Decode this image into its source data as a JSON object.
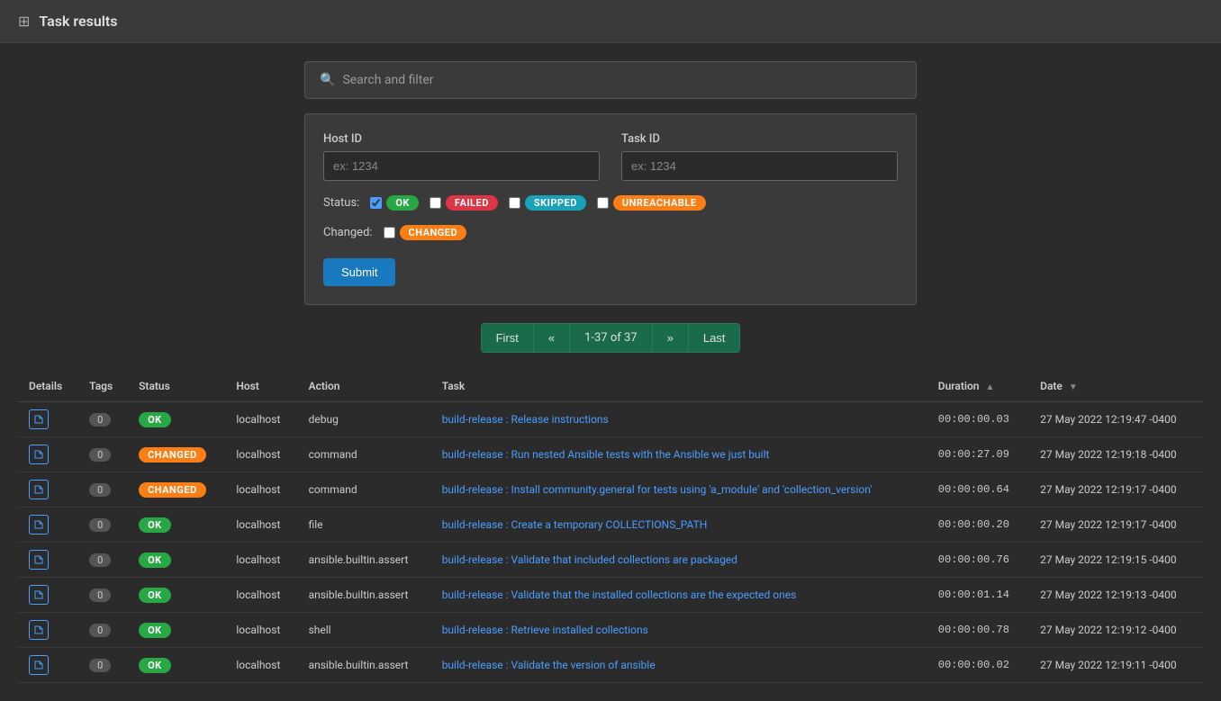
{
  "header": {
    "icon": "⊞",
    "title": "Task results"
  },
  "search": {
    "placeholder": "Search and filter"
  },
  "filters": {
    "host_id_label": "Host ID",
    "host_id_placeholder": "ex: 1234",
    "task_id_label": "Task ID",
    "task_id_placeholder": "ex: 1234",
    "status_label": "Status:",
    "changed_label": "Changed:",
    "submit_label": "Submit"
  },
  "status_badges": [
    {
      "label": "OK",
      "class": "badge-ok",
      "checked": true
    },
    {
      "label": "FAILED",
      "class": "badge-failed",
      "checked": false
    },
    {
      "label": "SKIPPED",
      "class": "badge-skipped",
      "checked": false
    },
    {
      "label": "UNREACHABLE",
      "class": "badge-unreachable",
      "checked": false
    }
  ],
  "pagination": {
    "first": "First",
    "prev": "«",
    "info": "1-37 of 37",
    "next": "»",
    "last": "Last"
  },
  "table": {
    "columns": [
      {
        "id": "details",
        "label": "Details",
        "sortable": false
      },
      {
        "id": "tags",
        "label": "Tags",
        "sortable": false
      },
      {
        "id": "status",
        "label": "Status",
        "sortable": false
      },
      {
        "id": "host",
        "label": "Host",
        "sortable": false
      },
      {
        "id": "action",
        "label": "Action",
        "sortable": false
      },
      {
        "id": "task",
        "label": "Task",
        "sortable": false
      },
      {
        "id": "duration",
        "label": "Duration",
        "sortable": true,
        "sort_dir": "asc"
      },
      {
        "id": "date",
        "label": "Date",
        "sortable": true,
        "sort_dir": "desc"
      }
    ],
    "rows": [
      {
        "tags": "0",
        "status": "OK",
        "status_class": "badge-ok",
        "host": "localhost",
        "action": "debug",
        "task": "build-release : Release instructions",
        "duration": "00:00:00.03",
        "date": "27 May 2022 12:19:47 -0400"
      },
      {
        "tags": "0",
        "status": "CHANGED",
        "status_class": "badge-changed",
        "host": "localhost",
        "action": "command",
        "task": "build-release : Run nested Ansible tests with the Ansible we just built",
        "duration": "00:00:27.09",
        "date": "27 May 2022 12:19:18 -0400"
      },
      {
        "tags": "0",
        "status": "CHANGED",
        "status_class": "badge-changed",
        "host": "localhost",
        "action": "command",
        "task": "build-release : Install community.general for tests using 'a_module' and 'collection_version'",
        "duration": "00:00:00.64",
        "date": "27 May 2022 12:19:17 -0400"
      },
      {
        "tags": "0",
        "status": "OK",
        "status_class": "badge-ok",
        "host": "localhost",
        "action": "file",
        "task": "build-release : Create a temporary COLLECTIONS_PATH",
        "duration": "00:00:00.20",
        "date": "27 May 2022 12:19:17 -0400"
      },
      {
        "tags": "0",
        "status": "OK",
        "status_class": "badge-ok",
        "host": "localhost",
        "action": "ansible.builtin.assert",
        "task": "build-release : Validate that included collections are packaged",
        "duration": "00:00:00.76",
        "date": "27 May 2022 12:19:15 -0400"
      },
      {
        "tags": "0",
        "status": "OK",
        "status_class": "badge-ok",
        "host": "localhost",
        "action": "ansible.builtin.assert",
        "task": "build-release : Validate that the installed collections are the expected ones",
        "duration": "00:00:01.14",
        "date": "27 May 2022 12:19:13 -0400"
      },
      {
        "tags": "0",
        "status": "OK",
        "status_class": "badge-ok",
        "host": "localhost",
        "action": "shell",
        "task": "build-release : Retrieve installed collections",
        "duration": "00:00:00.78",
        "date": "27 May 2022 12:19:12 -0400"
      },
      {
        "tags": "0",
        "status": "OK",
        "status_class": "badge-ok",
        "host": "localhost",
        "action": "ansible.builtin.assert",
        "task": "build-release : Validate the version of ansible",
        "duration": "00:00:00.02",
        "date": "27 May 2022 12:19:11 -0400"
      }
    ]
  }
}
